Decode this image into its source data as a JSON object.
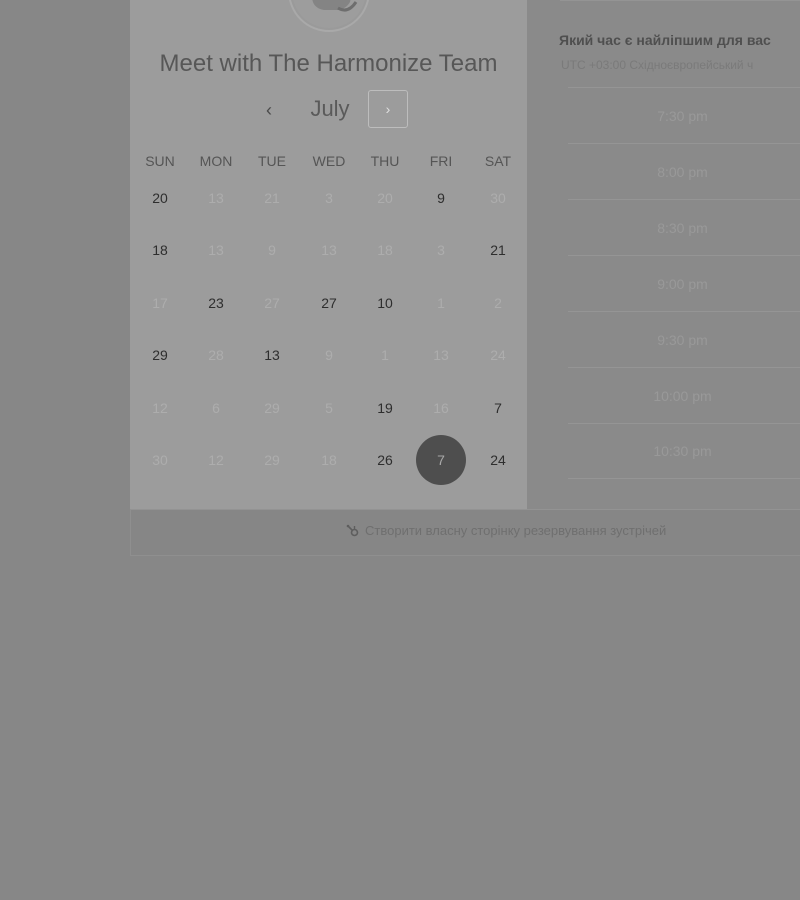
{
  "header": {
    "title": "Meet with The Harmonize Team"
  },
  "calendar": {
    "month": "July",
    "prev_icon": "chevron-left-icon",
    "next_icon": "chevron-right-icon",
    "weekdays": [
      "SUN",
      "MON",
      "TUE",
      "WED",
      "THU",
      "FRI",
      "SAT"
    ],
    "weeks": [
      [
        {
          "d": "20",
          "s": "active"
        },
        {
          "d": "13",
          "s": "inactive"
        },
        {
          "d": "21",
          "s": "inactive"
        },
        {
          "d": "3",
          "s": "inactive"
        },
        {
          "d": "20",
          "s": "inactive"
        },
        {
          "d": "9",
          "s": "active"
        },
        {
          "d": "30",
          "s": "inactive"
        }
      ],
      [
        {
          "d": "18",
          "s": "active"
        },
        {
          "d": "13",
          "s": "inactive"
        },
        {
          "d": "9",
          "s": "inactive"
        },
        {
          "d": "13",
          "s": "inactive"
        },
        {
          "d": "18",
          "s": "inactive"
        },
        {
          "d": "3",
          "s": "inactive"
        },
        {
          "d": "21",
          "s": "active"
        }
      ],
      [
        {
          "d": "17",
          "s": "inactive"
        },
        {
          "d": "23",
          "s": "active"
        },
        {
          "d": "27",
          "s": "inactive"
        },
        {
          "d": "27",
          "s": "active"
        },
        {
          "d": "10",
          "s": "active"
        },
        {
          "d": "1",
          "s": "inactive"
        },
        {
          "d": "2",
          "s": "inactive"
        }
      ],
      [
        {
          "d": "29",
          "s": "active"
        },
        {
          "d": "28",
          "s": "inactive"
        },
        {
          "d": "13",
          "s": "active"
        },
        {
          "d": "9",
          "s": "inactive"
        },
        {
          "d": "1",
          "s": "inactive"
        },
        {
          "d": "13",
          "s": "inactive"
        },
        {
          "d": "24",
          "s": "inactive"
        }
      ],
      [
        {
          "d": "12",
          "s": "inactive"
        },
        {
          "d": "6",
          "s": "inactive"
        },
        {
          "d": "29",
          "s": "inactive"
        },
        {
          "d": "5",
          "s": "inactive"
        },
        {
          "d": "19",
          "s": "active"
        },
        {
          "d": "16",
          "s": "inactive"
        },
        {
          "d": "7",
          "s": "active"
        }
      ],
      [
        {
          "d": "30",
          "s": "inactive"
        },
        {
          "d": "12",
          "s": "inactive"
        },
        {
          "d": "29",
          "s": "inactive"
        },
        {
          "d": "18",
          "s": "inactive"
        },
        {
          "d": "26",
          "s": "active"
        },
        {
          "d": "7",
          "s": "selected"
        },
        {
          "d": "24",
          "s": "active"
        }
      ]
    ]
  },
  "times": {
    "question": "Який час є найліпшим для вас",
    "timezone": "UTC +03:00 Східноєвропейський ч",
    "slots": [
      "7:30 pm",
      "8:00 pm",
      "8:30 pm",
      "9:00 pm",
      "9:30 pm",
      "10:00 pm",
      "10:30 pm"
    ]
  },
  "footer": {
    "link_label": "Створити власну сторінку резервування зустрічей",
    "icon": "hubspot-sprocket-icon"
  },
  "colors": {
    "selected_day": "#4e4e4e",
    "panel_bg": "#9c9c9c",
    "overlay_bg": "#878787"
  }
}
